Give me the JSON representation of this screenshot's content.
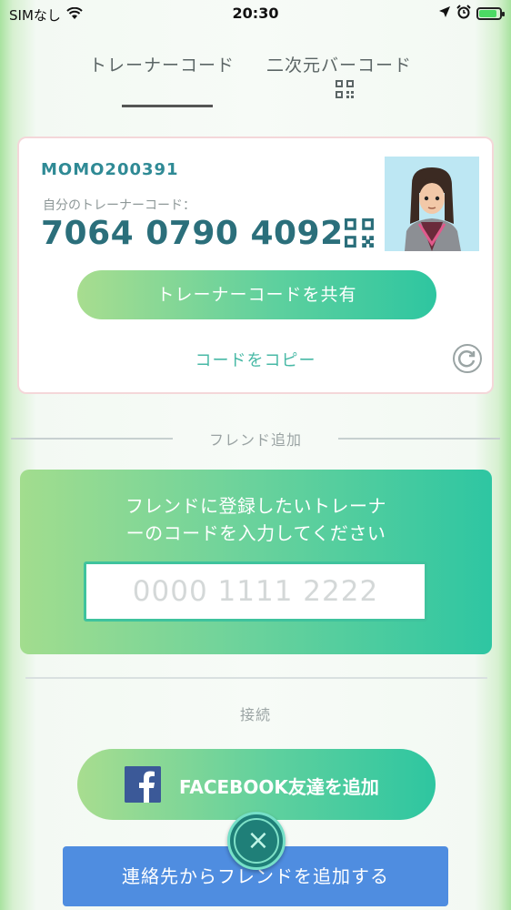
{
  "status_bar": {
    "carrier": "SIMなし",
    "time": "20:30",
    "battery_level": 0.85
  },
  "tabs": [
    {
      "label": "トレーナーコード",
      "active": true
    },
    {
      "label": "二次元バーコード",
      "active": false,
      "icon": "qr-code-icon"
    }
  ],
  "trainer_card": {
    "username": "MOMO200391",
    "code_label": "自分のトレーナーコード：",
    "code_value": "7064 0790 4092",
    "share_button": "トレーナーコードを共有",
    "copy_link": "コードをコピー",
    "icons": [
      "qr-code-icon",
      "refresh-icon"
    ]
  },
  "add_friend": {
    "section_title": "フレンド追加",
    "prompt_line1": "フレンドに登録したいトレーナ",
    "prompt_line2": "ーのコードを入力してください",
    "input_placeholder": "0000 1111 2222"
  },
  "connect": {
    "section_title": "接続",
    "facebook_button": "FACEBOOK友達を追加",
    "contacts_button": "連絡先からフレンドを追加する"
  },
  "colors": {
    "accent_teal": "#2f8a95",
    "gradient_start": "#a8dd8f",
    "gradient_end": "#2ec6a0",
    "contacts_blue": "#4f8de0",
    "facebook_blue": "#3b5998"
  }
}
